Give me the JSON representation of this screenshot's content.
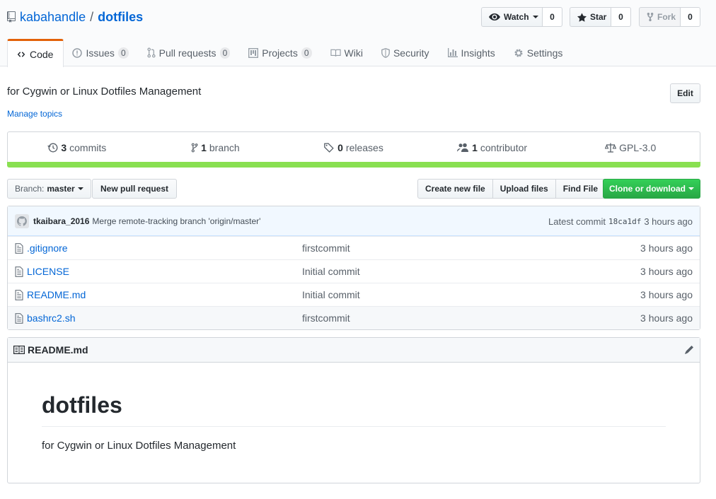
{
  "repo": {
    "owner": "kabahandle",
    "separator": "/",
    "name": "dotfiles"
  },
  "actions": {
    "watch": {
      "label": "Watch",
      "count": "0"
    },
    "star": {
      "label": "Star",
      "count": "0"
    },
    "fork": {
      "label": "Fork",
      "count": "0"
    }
  },
  "tabs": [
    {
      "label": "Code",
      "icon": "code-icon",
      "active": true
    },
    {
      "label": "Issues",
      "count": "0",
      "icon": "issue-icon"
    },
    {
      "label": "Pull requests",
      "count": "0",
      "icon": "pull-request-icon"
    },
    {
      "label": "Projects",
      "count": "0",
      "icon": "project-icon"
    },
    {
      "label": "Wiki",
      "icon": "book-icon"
    },
    {
      "label": "Security",
      "icon": "shield-icon"
    },
    {
      "label": "Insights",
      "icon": "graph-icon"
    },
    {
      "label": "Settings",
      "icon": "gear-icon"
    }
  ],
  "description": "for Cygwin or Linux Dotfiles Management",
  "manage_topics": "Manage topics",
  "edit_label": "Edit",
  "summary": {
    "commits": {
      "num": "3",
      "label": "commits"
    },
    "branch": {
      "num": "1",
      "label": "branch"
    },
    "releases": {
      "num": "0",
      "label": "releases"
    },
    "contributors": {
      "num": "1",
      "label": "contributor"
    },
    "license": "GPL-3.0"
  },
  "language_bar_color": "#89e051",
  "file_nav": {
    "branch_prefix": "Branch:",
    "branch": "master",
    "new_pr": "New pull request",
    "create_file": "Create new file",
    "upload_files": "Upload files",
    "find_file": "Find File",
    "clone": "Clone or download"
  },
  "latest_commit": {
    "author": "tkaibara_2016",
    "message": "Merge remote-tracking branch 'origin/master'",
    "prefix": "Latest commit",
    "sha": "18ca1df",
    "age": "3 hours ago"
  },
  "files": [
    {
      "name": ".gitignore",
      "message": "firstcommit",
      "age": "3 hours ago"
    },
    {
      "name": "LICENSE",
      "message": "Initial commit",
      "age": "3 hours ago"
    },
    {
      "name": "README.md",
      "message": "Initial commit",
      "age": "3 hours ago"
    },
    {
      "name": "bashrc2.sh",
      "message": "firstcommit",
      "age": "3 hours ago"
    }
  ],
  "readme": {
    "filename": "README.md",
    "heading": "dotfiles",
    "body": "for Cygwin or Linux Dotfiles Management"
  },
  "colors": {
    "link": "#0366d6",
    "tab_accent": "#e36209",
    "clone_green": "#28a745"
  }
}
